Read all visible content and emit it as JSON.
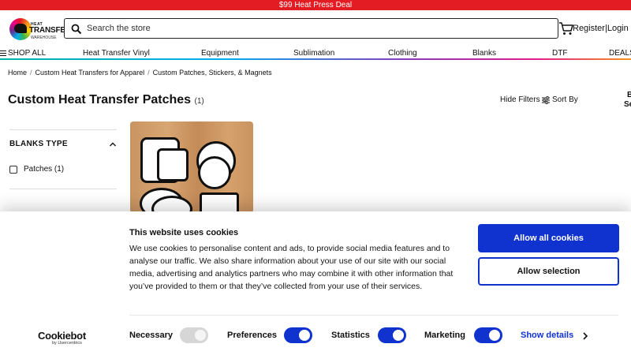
{
  "promo": {
    "text": "$99 Heat Press Deal",
    "color": "#e31b23"
  },
  "header": {
    "logo": {
      "line1": "HEAT",
      "line2": "TRANSFER",
      "line3": "WAREHOUSE"
    },
    "search_placeholder": "Search the store",
    "register_label": "Register",
    "divider": "|",
    "login_label": "Login"
  },
  "nav": {
    "items": [
      "SHOP ALL",
      "Heat Transfer Vinyl",
      "Equipment",
      "Sublimation",
      "Clothing",
      "Blanks",
      "DTF",
      "DEALS"
    ]
  },
  "breadcrumb": [
    "Home",
    "Custom Heat Transfers for Apparel",
    "Custom Patches, Stickers, & Magnets"
  ],
  "page": {
    "title": "Custom Heat Transfer Patches",
    "count": "(1)",
    "hide_filters": "Hide Filters",
    "sort_by": "Sort By",
    "edge_line1": "B",
    "edge_line2": "Se"
  },
  "filters": {
    "heading": "BLANKS TYPE",
    "options": [
      {
        "label": "Patches (1)",
        "checked": false
      }
    ]
  },
  "cookie_banner": {
    "title": "This website uses cookies",
    "body": "We use cookies to personalise content and ads, to provide social media features and to analyse our traffic. We also share information about your use of our site with our social media, advertising and analytics partners who may combine it with other information that you’ve provided to them or that they’ve collected from your use of their services.",
    "allow_all": "Allow all cookies",
    "allow_selection": "Allow selection",
    "brand": "Cookiebot",
    "brand_sub": "by Usercentrics",
    "consents": [
      {
        "label": "Necessary",
        "enabled": true,
        "locked": true
      },
      {
        "label": "Preferences",
        "enabled": true
      },
      {
        "label": "Statistics",
        "enabled": true
      },
      {
        "label": "Marketing",
        "enabled": true
      }
    ],
    "show_details": "Show details",
    "accent": "#1032cf"
  }
}
